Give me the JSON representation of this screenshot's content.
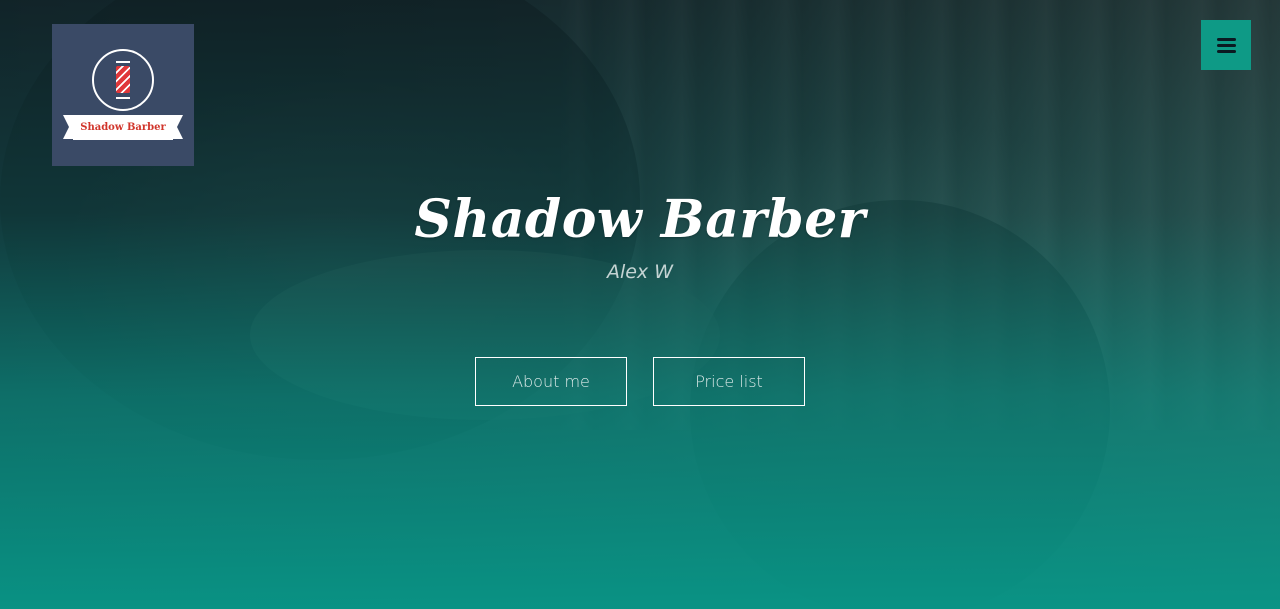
{
  "logo": {
    "text": "Shadow Barber",
    "icon": "barber-pole-icon"
  },
  "menu": {
    "icon": "hamburger-menu-icon"
  },
  "hero": {
    "title": "Shadow Barber",
    "subtitle": "Alex W",
    "buttons": [
      {
        "label": "About me"
      },
      {
        "label": "Price list"
      }
    ]
  },
  "colors": {
    "accent": "#0e9a86",
    "logo_bg": "#3a4a66",
    "logo_text": "#d1352b"
  }
}
